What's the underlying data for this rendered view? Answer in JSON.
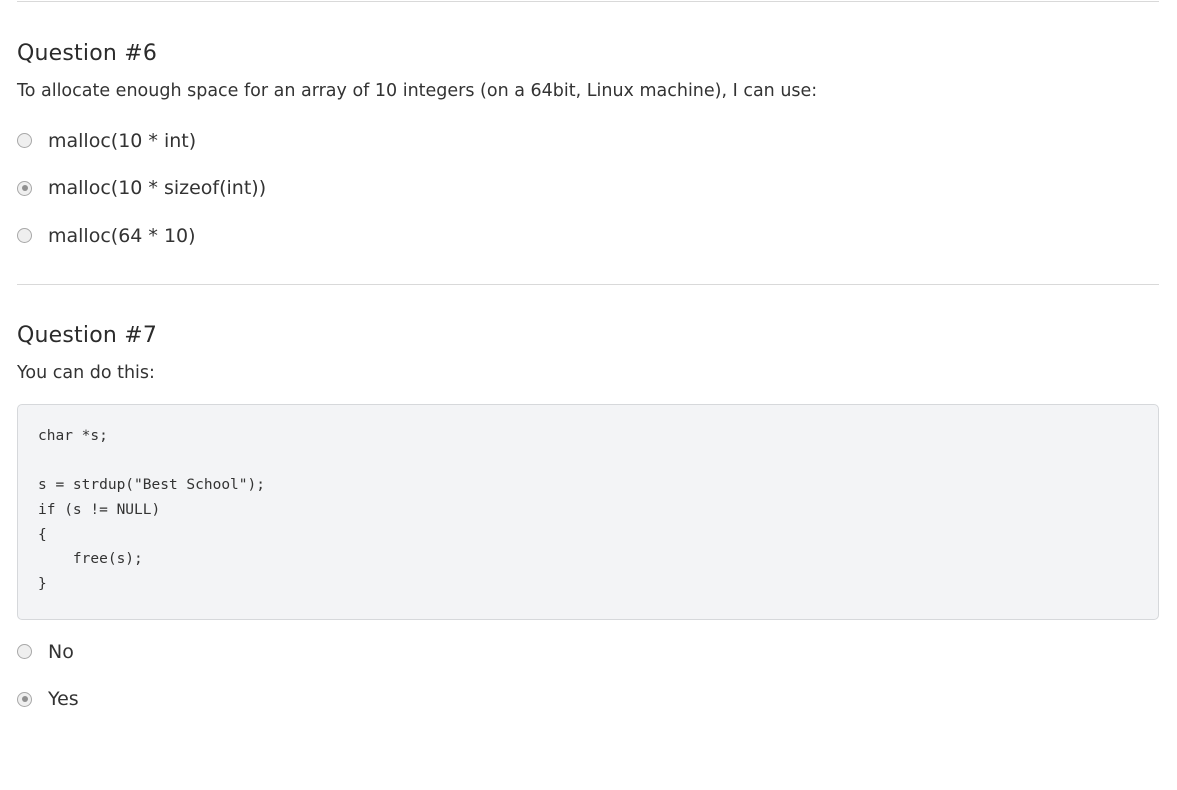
{
  "q6": {
    "title": "Question #6",
    "text": "To allocate enough space for an array of 10 integers (on a 64bit, Linux machine), I can use:",
    "options": [
      {
        "label": "malloc(10 * int)",
        "selected": false
      },
      {
        "label": "malloc(10 * sizeof(int))",
        "selected": true
      },
      {
        "label": "malloc(64 * 10)",
        "selected": false
      }
    ]
  },
  "q7": {
    "title": "Question #7",
    "text": "You can do this:",
    "code": [
      "char *s;",
      "",
      "s = strdup(\"Best School\");",
      "if (s != NULL)",
      "{",
      "    free(s);",
      "}"
    ],
    "options": [
      {
        "label": "No",
        "selected": false
      },
      {
        "label": "Yes",
        "selected": true
      }
    ]
  }
}
